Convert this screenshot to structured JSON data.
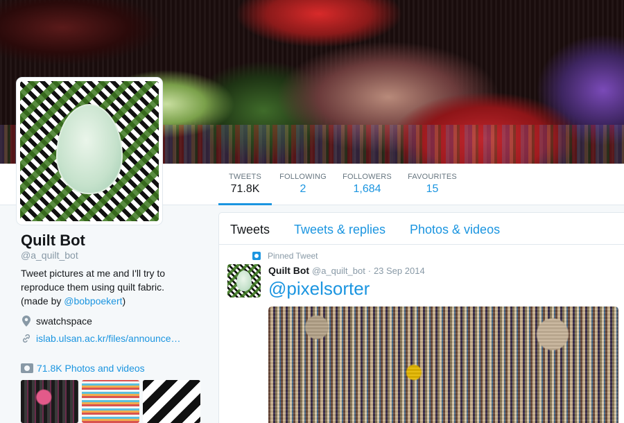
{
  "profile": {
    "name": "Quilt Bot",
    "handle": "@a_quilt_bot",
    "bio_text": "Tweet pictures at me and I'll try to reproduce them using quilt fabric. (made by ",
    "bio_mention": "@bobpoekert",
    "bio_end": ")",
    "location": "swatchspace",
    "url": "islab.ulsan.ac.kr/files/announce…",
    "photos_label": "71.8K Photos and videos"
  },
  "stats": {
    "tweets": {
      "label": "TWEETS",
      "value": "71.8K"
    },
    "following": {
      "label": "FOLLOWING",
      "value": "2"
    },
    "followers": {
      "label": "FOLLOWERS",
      "value": "1,684"
    },
    "favourites": {
      "label": "FAVOURITES",
      "value": "15"
    }
  },
  "timeline": {
    "tabs": [
      "Tweets",
      "Tweets & replies",
      "Photos & videos"
    ],
    "pinned_label": "Pinned Tweet",
    "tweet": {
      "name": "Quilt Bot",
      "handle": "@a_quilt_bot",
      "separator": "·",
      "date": "23 Sep 2014",
      "text": "@pixelsorter"
    }
  },
  "colors": {
    "accent": "#1b95e0",
    "text": "#14171a",
    "muted": "#8899a6",
    "background": "#f5f8fa"
  },
  "icons": {
    "location": "map-pin-icon",
    "url": "link-icon",
    "photos": "camera-icon",
    "pinned": "pin-icon"
  }
}
